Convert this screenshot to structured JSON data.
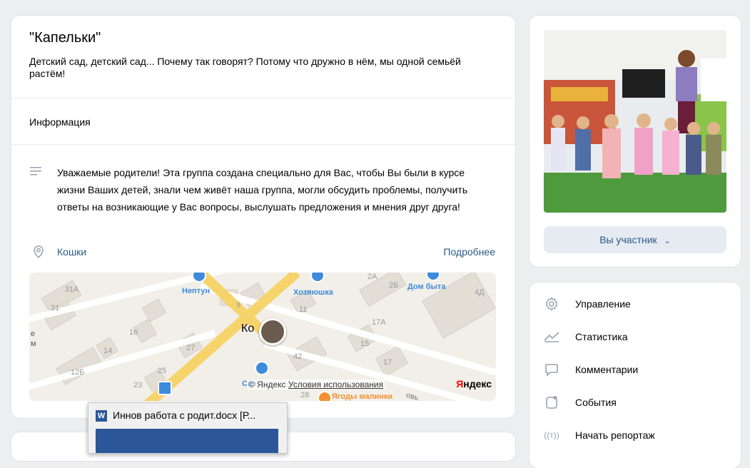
{
  "group": {
    "title": "\"Капельки\"",
    "status": "Детский сад, детский сад... Почему так говорят? Потому что дружно в нём, мы одной семьёй растём!",
    "tab_info": "Информация",
    "description": "Уважаемые родители! Эта группа создана специально для Вас, чтобы Вы были в курсе жизни Ваших детей, знали чем живёт наша группа, могли обсудить проблемы, получить ответы на возникающие у Вас вопросы, выслушать предложения и мнения друг друга!",
    "location": "Кошки",
    "more_link": "Подробнее"
  },
  "map": {
    "labels": [
      "31А",
      "31",
      "16",
      "14",
      "27",
      "12Б",
      "25",
      "23",
      "9",
      "11",
      "17А",
      "15",
      "17",
      "42",
      "2А",
      "2Б",
      "4Д",
      "28"
    ],
    "poi": [
      "Нептун",
      "Хозяюшка",
      "Дом быта",
      "Свя"
    ],
    "marker_label": "Ко",
    "edge_letters": [
      "е",
      "м"
    ],
    "footer_prefix": "© Яндекс",
    "footer_terms": "Условия использования",
    "brand_first": "Я",
    "brand_rest": "ндекс",
    "bottom_poi": "Ягоды малинки",
    "bottom_street": "овь"
  },
  "sidebar": {
    "member_button": "Вы участник",
    "menu": [
      {
        "label": "Управление",
        "icon": "gear-icon"
      },
      {
        "label": "Статистика",
        "icon": "chart-icon"
      },
      {
        "label": "Комментарии",
        "icon": "comment-icon"
      },
      {
        "label": "События",
        "icon": "event-icon"
      },
      {
        "label": "Начать репортаж",
        "icon": "broadcast-icon"
      }
    ]
  },
  "taskbar_preview": {
    "title": "Иннов работа с родит.docx [Р...",
    "app_letter": "W"
  },
  "colors": {
    "link": "#2a5885",
    "background": "#edeef0",
    "button_bg": "#e5ebf1",
    "icon": "#99a2ad"
  }
}
